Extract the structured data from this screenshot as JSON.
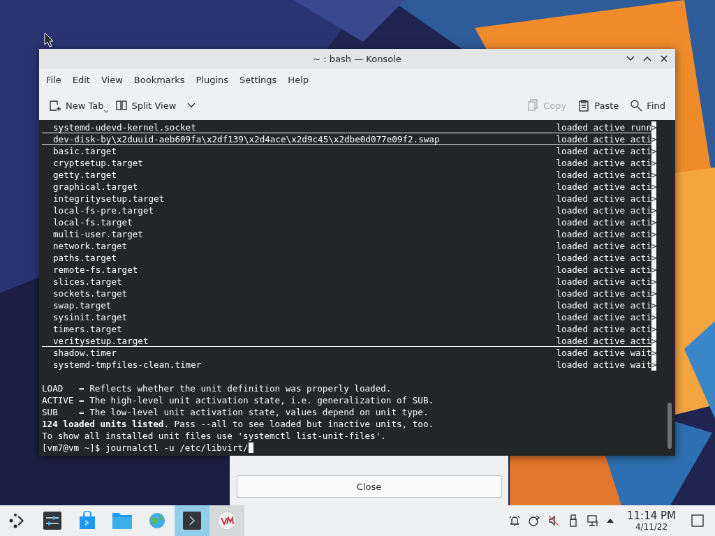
{
  "window": {
    "title": "~ : bash — Konsole"
  },
  "menu": [
    "File",
    "Edit",
    "View",
    "Bookmarks",
    "Plugins",
    "Settings",
    "Help"
  ],
  "toolbar": {
    "left": [
      {
        "kind": "new-tab",
        "label": "New Tab"
      },
      {
        "kind": "split",
        "label": "Split View"
      }
    ],
    "right": [
      {
        "kind": "copy",
        "label": "Copy",
        "disabled": true
      },
      {
        "kind": "paste",
        "label": "Paste",
        "disabled": false
      },
      {
        "kind": "find",
        "label": "Find",
        "disabled": false
      }
    ]
  },
  "terminal": {
    "rows": [
      {
        "name": "systemd-udevd-kernel.socket",
        "status": "loaded active runn",
        "more": ">",
        "underlined": true
      },
      {
        "name": "dev-disk-by\\x2duuid-aeb609fa\\x2df139\\x2d4ace\\x2d9c45\\x2dbe0d077e09f2.swap",
        "status": "loaded active acti",
        "more": ">",
        "underlined": true
      },
      {
        "name": "basic.target",
        "status": "loaded active acti",
        "more": ">",
        "underlined": false
      },
      {
        "name": "cryptsetup.target",
        "status": "loaded active acti",
        "more": ">",
        "underlined": false
      },
      {
        "name": "getty.target",
        "status": "loaded active acti",
        "more": ">",
        "underlined": false
      },
      {
        "name": "graphical.target",
        "status": "loaded active acti",
        "more": ">",
        "underlined": false
      },
      {
        "name": "integritysetup.target",
        "status": "loaded active acti",
        "more": ">",
        "underlined": false
      },
      {
        "name": "local-fs-pre.target",
        "status": "loaded active acti",
        "more": ">",
        "underlined": false
      },
      {
        "name": "local-fs.target",
        "status": "loaded active acti",
        "more": ">",
        "underlined": false
      },
      {
        "name": "multi-user.target",
        "status": "loaded active acti",
        "more": ">",
        "underlined": false
      },
      {
        "name": "network.target",
        "status": "loaded active acti",
        "more": ">",
        "underlined": false
      },
      {
        "name": "paths.target",
        "status": "loaded active acti",
        "more": ">",
        "underlined": false
      },
      {
        "name": "remote-fs.target",
        "status": "loaded active acti",
        "more": ">",
        "underlined": false
      },
      {
        "name": "slices.target",
        "status": "loaded active acti",
        "more": ">",
        "underlined": false
      },
      {
        "name": "sockets.target",
        "status": "loaded active acti",
        "more": ">",
        "underlined": false
      },
      {
        "name": "swap.target",
        "status": "loaded active acti",
        "more": ">",
        "underlined": false
      },
      {
        "name": "sysinit.target",
        "status": "loaded active acti",
        "more": ">",
        "underlined": false
      },
      {
        "name": "timers.target",
        "status": "loaded active acti",
        "more": ">",
        "underlined": false
      },
      {
        "name": "veritysetup.target",
        "status": "loaded active acti",
        "more": ">",
        "underlined": true
      },
      {
        "name": "shadow.timer",
        "status": "loaded active wait",
        "more": ">",
        "underlined": false
      },
      {
        "name": "systemd-tmpfiles-clean.timer",
        "status": "loaded active wait",
        "more": ">",
        "underlined": false
      }
    ],
    "legend": [
      "LOAD   = Reflects whether the unit definition was properly loaded.",
      "ACTIVE = The high-level unit activation state, i.e. generalization of SUB.",
      "SUB    = The low-level unit activation state, values depend on unit type.",
      "**124 loaded units listed**. Pass --all to see loaded but inactive units, too.",
      "To show all installed unit files use 'systemctl list-unit-files'."
    ],
    "prompt": "[vm7@vm ~]$ journalctl -u /etc/libvirt/"
  },
  "dialog": {
    "button": "Close"
  },
  "taskbar": {
    "apps": [
      {
        "kind": "launcher",
        "selected": false,
        "hovered": false
      },
      {
        "kind": "settings",
        "selected": false,
        "hovered": false
      },
      {
        "kind": "store",
        "selected": false,
        "hovered": false
      },
      {
        "kind": "files",
        "selected": false,
        "hovered": false
      },
      {
        "kind": "browser",
        "selected": false,
        "hovered": false
      },
      {
        "kind": "terminal",
        "selected": true,
        "hovered": false
      },
      {
        "kind": "vm",
        "selected": false,
        "hovered": true
      }
    ],
    "tray": [
      {
        "kind": "bell"
      },
      {
        "kind": "network-share"
      },
      {
        "kind": "muted"
      },
      {
        "kind": "usb"
      },
      {
        "kind": "network"
      },
      {
        "kind": "expand"
      }
    ],
    "time": "11:14 PM",
    "date": "4/11/22"
  }
}
